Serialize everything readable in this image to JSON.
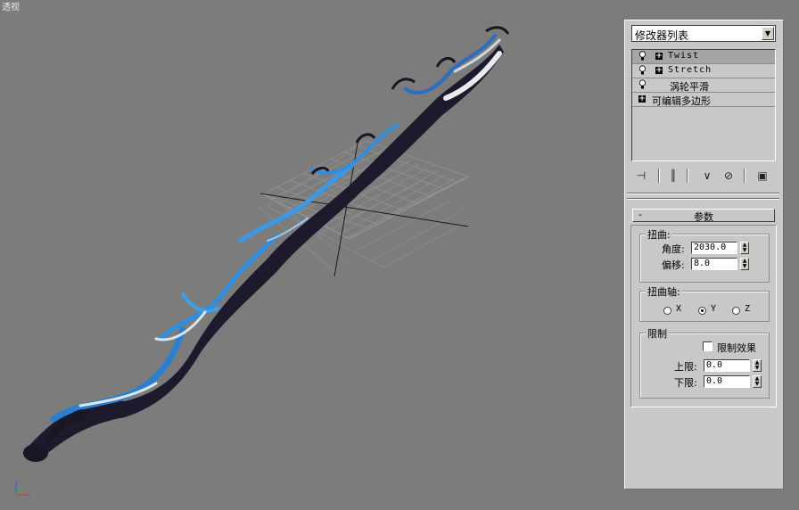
{
  "viewport": {
    "label": "透视"
  },
  "panel": {
    "modifier_list_label": "修改器列表",
    "stack": [
      {
        "label": "Twist",
        "selected": true,
        "has_bulb": true,
        "expandable": true
      },
      {
        "label": "Stretch",
        "selected": false,
        "has_bulb": true,
        "expandable": true
      },
      {
        "label": "涡轮平滑",
        "selected": false,
        "has_bulb": true,
        "expandable": false
      },
      {
        "label": "可编辑多边形",
        "selected": false,
        "has_bulb": false,
        "expandable": true
      }
    ],
    "toolbar_icons": [
      "pin-stack-icon",
      "show-end-result-icon",
      "make-unique-icon",
      "remove-modifier-icon",
      "configure-sets-icon"
    ]
  },
  "params": {
    "rollout_title": "参数",
    "rollout_toggle": "-",
    "twist_group": "扭曲:",
    "angle_label": "角度:",
    "angle_value": "2030.0",
    "bias_label": "偏移:",
    "bias_value": "8.0",
    "axis_group": "扭曲轴:",
    "axis_x": "X",
    "axis_y": "Y",
    "axis_z": "Z",
    "axis_selected": "Y",
    "limits_group": "限制",
    "limit_effect_label": "限制效果",
    "limit_effect_checked": false,
    "upper_label": "上限:",
    "upper_value": "0.0",
    "lower_label": "下限:",
    "lower_value": "0.0"
  }
}
